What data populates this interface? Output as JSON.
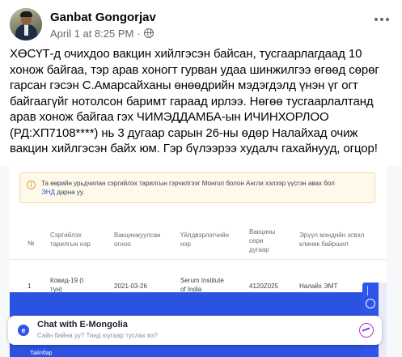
{
  "post": {
    "author": "Ganbat Gongorjav",
    "date": "April 1 at 8:25 PM",
    "separator": "·",
    "privacy_icon": "globe-icon",
    "more_icon": "more-options-icon",
    "text": "ХӨСҮТ-д очихдоо вакцин хийлгэсэн байсан, тусгаарлагдаад 10 хонож байгаа, тэр арав хоногт гурван удаа шинжилгээ өгөөд сөрөг гарсан гэсэн С.Амарсайханы өнөөдрийн мэдэгдэлд үнэн үг огт байгаагүйг нотолсон баримт гараад ирлээ. Нөгөө тусгаарлалтанд арав хонож байгаа гэх ЧИМЭДДАМБА-ын ИЧИНХОРЛОО (РД:ХП7108****) нь 3 дугаар сарын 26-ны өдөр Налайхад очиж вакцин хийлгэсэн байх юм. Гэр бүлээрээ худалч гахайнууд, огцор!"
  },
  "screenshot": {
    "notice": {
      "text": "Та өөрийн урьдчилан сэргийлэх тарилгын гэрчилгээг Монгол болон Англи хэлээр үүсгэн авах бол",
      "link": "ЭНД",
      "suffix": "дарна уу."
    },
    "columns": [
      "№",
      "Сэргийлэх тарилгын нэр",
      "Вакцинжуулсан огноо",
      "Үйлдвэрлэгчийн нэр",
      "Вакцины сери дугаар",
      "Эрүүл мэндийн эсвэл клиник байршил"
    ],
    "rows": [
      {
        "no": "1",
        "name": "Ковид-19 (I тун)",
        "date": "2021-03-26",
        "manufacturer": "Serum Institute of India",
        "serial": "4120Z025",
        "location": "Налайх ЭМТ"
      }
    ],
    "chat": {
      "title": "Chat with E-Mongolia",
      "subtitle": "Сайн байна уу? Танд юугаар туслах вэ?",
      "logo_letter": "e",
      "messenger_icon": "messenger-icon"
    },
    "footer_text": "Тайлбар"
  }
}
